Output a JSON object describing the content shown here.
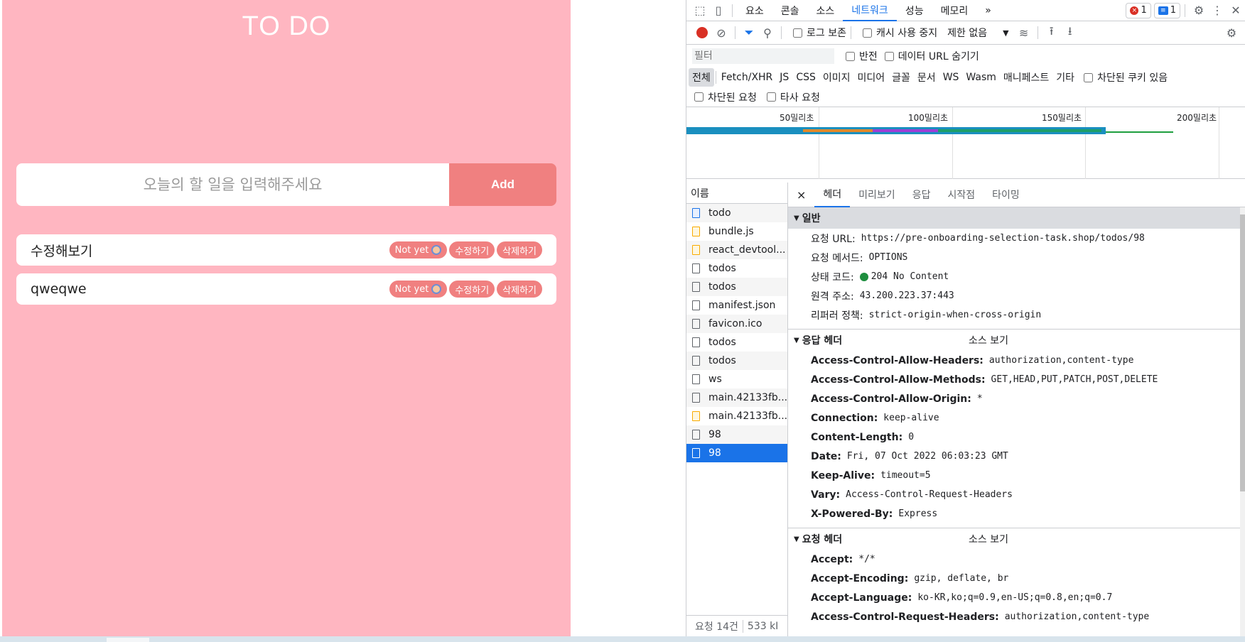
{
  "app": {
    "title": "TO DO",
    "input_placeholder": "오늘의 할 일을 입력해주세요",
    "add_label": "Add",
    "todos": [
      {
        "text": "수정해보기",
        "status": "Not yet",
        "edit": "수정하기",
        "delete": "삭제하기"
      },
      {
        "text": "qweqwe",
        "status": "Not yet",
        "edit": "수정하기",
        "delete": "삭제하기"
      }
    ]
  },
  "devtools": {
    "tabs": [
      "요소",
      "콘솔",
      "소스",
      "네트워크",
      "성능",
      "메모리"
    ],
    "more": "»",
    "error_count": "1",
    "message_count": "1",
    "toolbar": {
      "preserve_log": "로그 보존",
      "disable_cache": "캐시 사용 중지",
      "throttle": "제한 없음"
    },
    "filter": {
      "placeholder": "필터",
      "invert": "반전",
      "hide_data_urls": "데이터 URL 숨기기"
    },
    "types": [
      "전체",
      "Fetch/XHR",
      "JS",
      "CSS",
      "이미지",
      "미디어",
      "글꼴",
      "문서",
      "WS",
      "Wasm",
      "매니페스트",
      "기타"
    ],
    "blocked_cookies": "차단된 쿠키 있음",
    "blocked_requests": "차단된 요청",
    "third_party": "타사 요청",
    "timeline_ticks": [
      "50밀리초",
      "100밀리초",
      "150밀리초",
      "200밀리초"
    ],
    "names_header": "이름",
    "requests": [
      {
        "name": "todo",
        "kind": "doc"
      },
      {
        "name": "bundle.js",
        "kind": "js"
      },
      {
        "name": "react_devtool...",
        "kind": "js"
      },
      {
        "name": "todos",
        "kind": "plain"
      },
      {
        "name": "todos",
        "kind": "plain"
      },
      {
        "name": "manifest.json",
        "kind": "plain"
      },
      {
        "name": "favicon.ico",
        "kind": "plain"
      },
      {
        "name": "todos",
        "kind": "plain"
      },
      {
        "name": "todos",
        "kind": "plain"
      },
      {
        "name": "ws",
        "kind": "plain"
      },
      {
        "name": "main.42133fb...",
        "kind": "plain"
      },
      {
        "name": "main.42133fb...",
        "kind": "js"
      },
      {
        "name": "98",
        "kind": "plain"
      },
      {
        "name": "98",
        "kind": "plain",
        "selected": true
      }
    ],
    "footer_requests": "요청 14건",
    "footer_size": "533 kI",
    "detail_close": "×",
    "detail_tabs": [
      "헤더",
      "미리보기",
      "응답",
      "시작점",
      "타이밍"
    ],
    "general": {
      "title": "일반",
      "rows": [
        {
          "k": "요청 URL:",
          "v": "https://pre-onboarding-selection-task.shop/todos/98"
        },
        {
          "k": "요청 메서드:",
          "v": "OPTIONS"
        },
        {
          "k": "상태 코드:",
          "v": "204 No Content",
          "status_dot": true
        },
        {
          "k": "원격 주소:",
          "v": "43.200.223.37:443"
        },
        {
          "k": "리퍼러 정책:",
          "v": "strict-origin-when-cross-origin"
        }
      ]
    },
    "response_headers": {
      "title": "응답 헤더",
      "view_source": "소스 보기",
      "rows": [
        {
          "k": "Access-Control-Allow-Headers:",
          "v": "authorization,content-type"
        },
        {
          "k": "Access-Control-Allow-Methods:",
          "v": "GET,HEAD,PUT,PATCH,POST,DELETE"
        },
        {
          "k": "Access-Control-Allow-Origin:",
          "v": "*"
        },
        {
          "k": "Connection:",
          "v": "keep-alive"
        },
        {
          "k": "Content-Length:",
          "v": "0"
        },
        {
          "k": "Date:",
          "v": "Fri, 07 Oct 2022 06:03:23 GMT"
        },
        {
          "k": "Keep-Alive:",
          "v": "timeout=5"
        },
        {
          "k": "Vary:",
          "v": "Access-Control-Request-Headers"
        },
        {
          "k": "X-Powered-By:",
          "v": "Express"
        }
      ]
    },
    "request_headers": {
      "title": "요청 헤더",
      "view_source": "소스 보기",
      "rows": [
        {
          "k": "Accept:",
          "v": "*/*"
        },
        {
          "k": "Accept-Encoding:",
          "v": "gzip, deflate, br"
        },
        {
          "k": "Accept-Language:",
          "v": "ko-KR,ko;q=0.9,en-US;q=0.8,en;q=0.7"
        },
        {
          "k": "Access-Control-Request-Headers:",
          "v": "authorization,content-type"
        }
      ]
    }
  }
}
